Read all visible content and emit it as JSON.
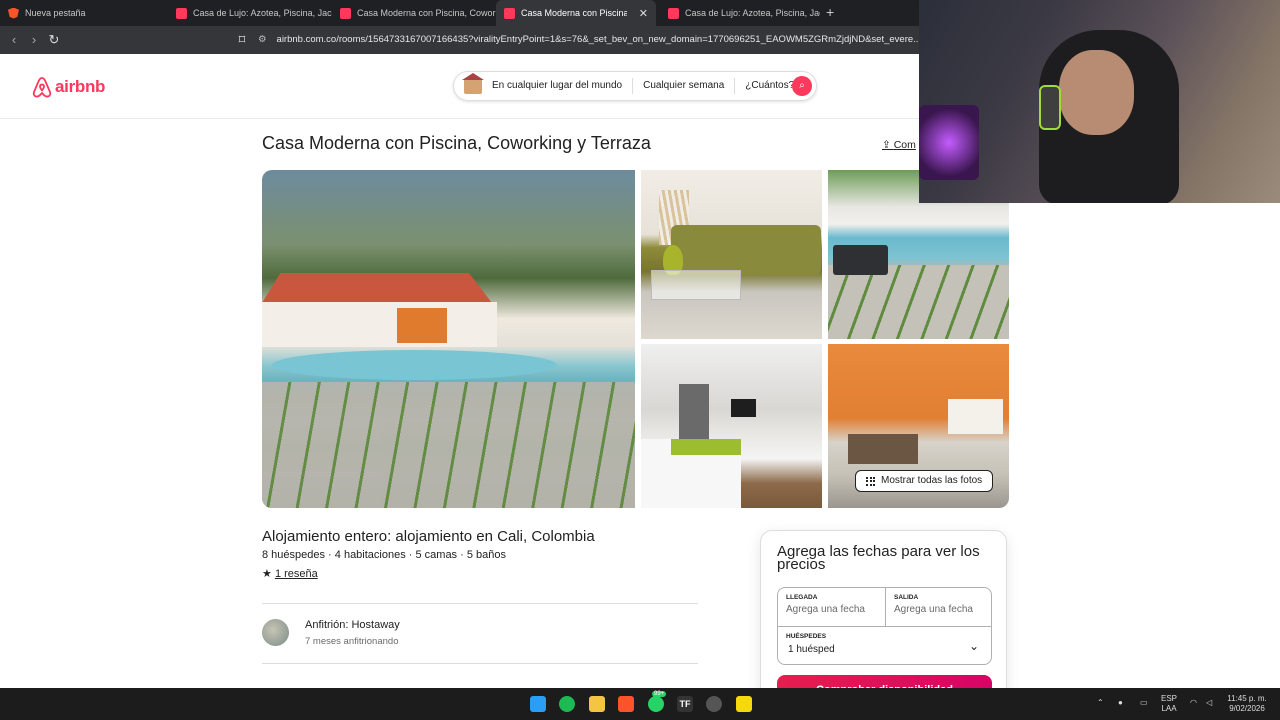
{
  "browser": {
    "tabs": [
      {
        "label": "Nueva pestaña"
      },
      {
        "label": "Casa de Lujo: Azotea, Piscina, Jacuzzi"
      },
      {
        "label": "Casa Moderna con Piscina, Coworkin"
      },
      {
        "label": "Casa Moderna con Piscina, Cow"
      },
      {
        "label": "Casa de Lujo: Azotea, Piscina, Jacuzzi"
      }
    ],
    "new_tab": "+",
    "close": "✕",
    "url": "airbnb.com.co/rooms/1564733167007166435?viralityEntryPoint=1&s=76&_set_bev_on_new_domain=1770696251_EAOWM5ZGRmZjdjND&set_evere..."
  },
  "header": {
    "logo": "airbnb",
    "search": {
      "where": "En cualquier lugar del mundo",
      "when": "Cualquier semana",
      "who": "¿Cuántos?"
    }
  },
  "listing": {
    "title": "Casa Moderna con Piscina, Coworking y Terraza",
    "share": "Com",
    "show_all_photos": "Mostrar todas las fotos",
    "subtitle": "Alojamiento entero: alojamiento en Cali, Colombia",
    "details": "8 huéspedes · 4 habitaciones · 5 camas · 5 baños",
    "rating_star": "★",
    "reviews": "1 reseña",
    "host_name": "Anfitrión: Hostaway",
    "host_since": "7 meses anfitrionando"
  },
  "booking": {
    "title": "Agrega las fechas para ver los precios",
    "checkin_label": "LLEGADA",
    "checkin_placeholder": "Agrega una fecha",
    "checkout_label": "SALIDA",
    "checkout_placeholder": "Agrega una fecha",
    "guests_label": "HUÉSPEDES",
    "guests_value": "1 huésped",
    "cta": "Comprobar disponibilidad"
  },
  "taskbar": {
    "lang": "ESP",
    "lang2": "LAA",
    "time": "11:45 p. m.",
    "date": "9/02/2026",
    "badge": "99+"
  },
  "colors": {
    "brand": "#ff385c",
    "chrome_bg": "#35363a"
  }
}
